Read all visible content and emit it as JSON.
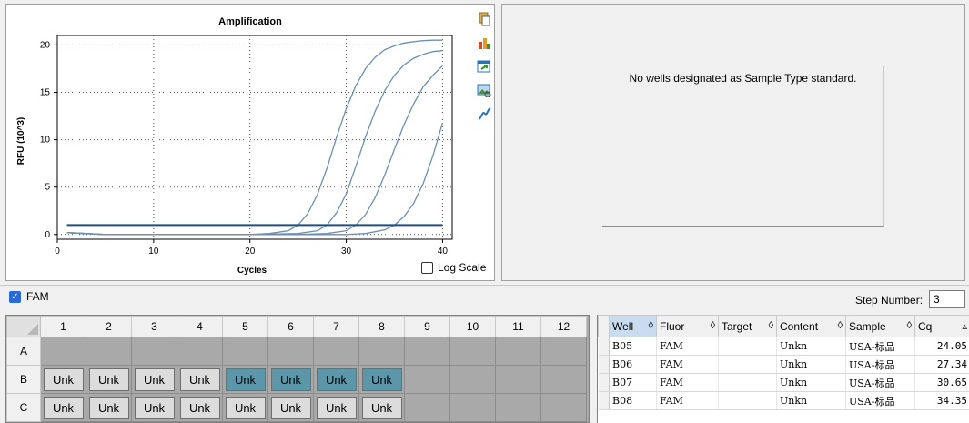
{
  "chart_data": {
    "type": "line",
    "title": "Amplification",
    "xlabel": "Cycles",
    "ylabel": "RFU (10^3)",
    "xlim": [
      0,
      41
    ],
    "ylim": [
      -0.5,
      21
    ],
    "xticks": [
      0,
      10,
      20,
      30,
      40
    ],
    "yticks": [
      0,
      5,
      10,
      15,
      20
    ],
    "grid": true,
    "threshold": 1.0,
    "series": [
      {
        "x": [
          1,
          5,
          10,
          15,
          20,
          22,
          24,
          25,
          26,
          27,
          28,
          29,
          30,
          31,
          32,
          33,
          34,
          35,
          36,
          37,
          38,
          39,
          40
        ],
        "y": [
          0.2,
          0,
          0,
          0,
          0,
          0.1,
          0.4,
          1.0,
          2.2,
          4.2,
          7.0,
          10.3,
          13.3,
          15.7,
          17.5,
          18.7,
          19.5,
          19.9,
          20.2,
          20.35,
          20.45,
          20.5,
          20.5
        ]
      },
      {
        "x": [
          1,
          5,
          10,
          15,
          20,
          25,
          27,
          28,
          29,
          30,
          31,
          32,
          33,
          34,
          35,
          36,
          37,
          38,
          39,
          40
        ],
        "y": [
          0.2,
          0,
          0,
          0,
          0,
          0.1,
          0.4,
          1.0,
          2.3,
          4.3,
          7.2,
          10.3,
          13.0,
          15.2,
          16.8,
          17.9,
          18.6,
          19.0,
          19.3,
          19.4
        ]
      },
      {
        "x": [
          1,
          5,
          10,
          15,
          20,
          25,
          28,
          30,
          31,
          32,
          33,
          34,
          35,
          36,
          37,
          38,
          39,
          40
        ],
        "y": [
          0.2,
          0,
          0,
          0,
          0,
          0,
          0.1,
          0.4,
          1.0,
          2.1,
          3.9,
          6.3,
          9.0,
          11.6,
          13.8,
          15.6,
          16.8,
          17.8
        ]
      },
      {
        "x": [
          1,
          5,
          10,
          15,
          20,
          25,
          30,
          32,
          33,
          34,
          35,
          36,
          37,
          38,
          39,
          40
        ],
        "y": [
          0.2,
          0,
          0,
          0,
          0,
          0,
          0,
          0.1,
          0.3,
          0.5,
          1.0,
          1.9,
          3.3,
          5.4,
          8.3,
          11.8
        ]
      }
    ],
    "colors": {
      "series": "#6c8fb4",
      "threshold": "#1f4e85",
      "grid": "#555555"
    }
  },
  "chart_panel": {
    "log_scale_label": "Log Scale",
    "toolbar_icons": [
      "copy-icon",
      "chart-settings-icon",
      "export-icon",
      "image-icon",
      "curve-fit-icon"
    ]
  },
  "std_panel": {
    "message": "No wells designated as Sample Type standard."
  },
  "fluor_bar": {
    "fam_label": "FAM",
    "step_label": "Step Number:",
    "step_value": "3"
  },
  "plate": {
    "columns": [
      "1",
      "2",
      "3",
      "4",
      "5",
      "6",
      "7",
      "8",
      "9",
      "10",
      "11",
      "12"
    ],
    "rows": [
      {
        "label": "A",
        "wells": [
          "",
          "",
          "",
          "",
          "",
          "",
          "",
          "",
          "",
          "",
          "",
          ""
        ]
      },
      {
        "label": "B",
        "wells": [
          "Unk",
          "Unk",
          "Unk",
          "Unk",
          "Unk",
          "Unk",
          "Unk",
          "Unk",
          "",
          "",
          "",
          ""
        ],
        "selected": [
          4,
          5,
          6,
          7
        ]
      },
      {
        "label": "C",
        "wells": [
          "Unk",
          "Unk",
          "Unk",
          "Unk",
          "Unk",
          "Unk",
          "Unk",
          "Unk",
          "",
          "",
          "",
          ""
        ],
        "selected": []
      }
    ]
  },
  "results": {
    "headers": [
      "Well",
      "Fluor",
      "Target",
      "Content",
      "Sample",
      "Cq"
    ],
    "sort_glyphs": [
      "◊",
      "◊",
      "◊",
      "◊",
      "◊",
      "▵"
    ],
    "rows": [
      [
        "B05",
        "FAM",
        "",
        "Unkn",
        "USA-标品",
        "24.05"
      ],
      [
        "B06",
        "FAM",
        "",
        "Unkn",
        "USA-标品",
        "27.34"
      ],
      [
        "B07",
        "FAM",
        "",
        "Unkn",
        "USA-标品",
        "30.65"
      ],
      [
        "B08",
        "FAM",
        "",
        "Unkn",
        "USA-标品",
        "34.35"
      ]
    ]
  }
}
